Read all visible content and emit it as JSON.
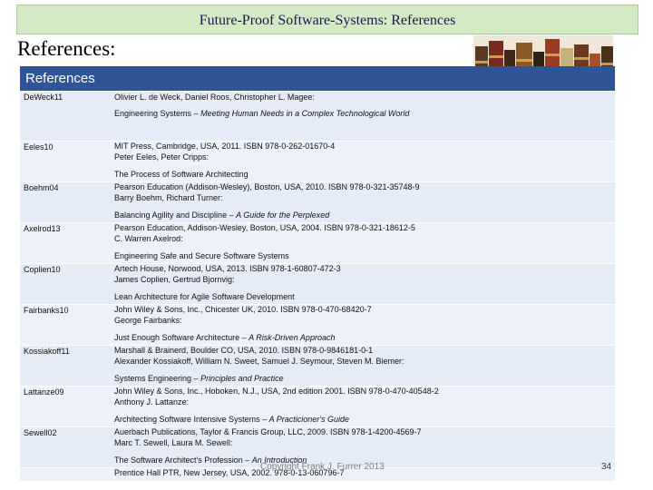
{
  "title": "Future-Proof Software-Systems: References",
  "heading": "References:",
  "table_header": "References",
  "references": [
    {
      "key": "DeWeck11",
      "authors": "Olivier L. de Weck, Daniel Roos, Christopher L. Magee:",
      "title_plain": "Engineering Systems – ",
      "title_italic": "Meeting Human Needs in a Complex Technological World",
      "publisher": "MIT Press, Cambridge, USA, 2011. ISBN 978-0-262-01670-4"
    },
    {
      "key": "Eeles10",
      "authors": "Peter Eeles, Peter Cripps:",
      "title_plain": "The Process of Software Architecting",
      "title_italic": "",
      "publisher": "Pearson Education (Addison-Wesley), Boston, USA, 2010. ISBN 978-0-321-35748-9"
    },
    {
      "key": "Boehm04",
      "authors": "Barry Boehm, Richard Turner:",
      "title_plain": "Balancing Agility and Discipline – ",
      "title_italic": "A Guide for the Perplexed",
      "publisher": "Pearson Education, Addison-Wesley, Boston, USA, 2004. ISBN 978-0-321-18612-5"
    },
    {
      "key": "Axelrod13",
      "authors": "C. Warren Axelrod:",
      "title_plain": "Engineering Safe and Secure Software Systems",
      "title_italic": "",
      "publisher": "Artech House, Norwood, USA, 2013. ISBN 978-1-60807-472-3"
    },
    {
      "key": "Coplien10",
      "authors": "James Coplien, Gertrud Bjornvig:",
      "title_plain": "Lean Architecture for Agile Software Development",
      "title_italic": "",
      "publisher": "John Wiley & Sons, Inc., Chicester UK, 2010. ISBN 978-0-470-68420-7"
    },
    {
      "key": "Fairbanks10",
      "authors": "George Fairbanks:",
      "title_plain": "Just Enough Software Architecture – ",
      "title_italic": "A Risk-Driven Approach",
      "publisher": "Marshall & Brainerd, Boulder CO, USA, 2010. ISBN 978-0-9846181-0-1"
    },
    {
      "key": "Kossiakoff11",
      "authors": "Alexander Kossiakoff, William N. Sweet, Samuel J. Seymour, Steven M. Biemer:",
      "title_plain": "Systems Engineering – ",
      "title_italic": "Principles and Practice",
      "publisher": "John Wiley & Sons, Inc., Hoboken, N.J., USA, 2nd edition 2001. ISBN 978-0-470-40548-2"
    },
    {
      "key": "Lattanze09",
      "authors": "Anthony J. Lattanze:",
      "title_plain": "Architecting Software Intensive Systems – ",
      "title_italic": "A Practicioner's Guide",
      "publisher": "Auerbach Publications, Taylor & Francis Group, LLC, 2009. ISBN 978-1-4200-4569-7"
    },
    {
      "key": "Sewell02",
      "authors": "Marc T. Sewell, Laura M. Sewell:",
      "title_plain": "The Software Architect's Profession – ",
      "title_italic": "An Introduction",
      "publisher": "Prentice Hall PTR, New Jersey, USA, 2002. 978-0-13-060796-7"
    }
  ],
  "footer": "Copyright Frank J. Furrer 2013",
  "page_number": "34"
}
